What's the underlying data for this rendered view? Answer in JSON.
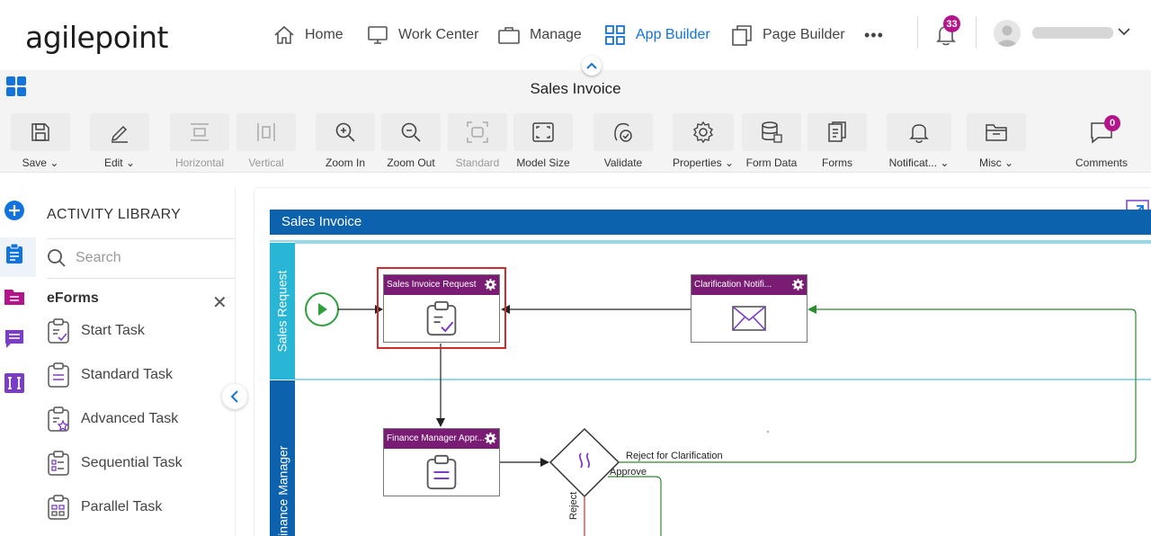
{
  "app": {
    "logo": "agilepoint"
  },
  "nav": {
    "items": [
      {
        "label": "Home",
        "icon": "home-icon"
      },
      {
        "label": "Work Center",
        "icon": "monitor-icon"
      },
      {
        "label": "Manage",
        "icon": "briefcase-icon"
      },
      {
        "label": "App Builder",
        "icon": "grid-icon",
        "active": true
      },
      {
        "label": "Page Builder",
        "icon": "pages-icon"
      }
    ],
    "more": "•••",
    "notification_count": "33"
  },
  "page": {
    "title": "Sales Invoice"
  },
  "toolbar": {
    "buttons": [
      {
        "label": "Save",
        "dropdown": true
      },
      {
        "label": "Edit",
        "dropdown": true
      },
      {
        "label": "Horizontal",
        "disabled": true
      },
      {
        "label": "Vertical",
        "disabled": true
      },
      {
        "label": "Zoom In"
      },
      {
        "label": "Zoom Out"
      },
      {
        "label": "Standard",
        "disabled": true
      },
      {
        "label": "Model Size"
      },
      {
        "label": "Validate"
      },
      {
        "label": "Properties",
        "dropdown": true
      },
      {
        "label": "Form Data"
      },
      {
        "label": "Forms"
      },
      {
        "label": "Notificat...",
        "dropdown": true
      },
      {
        "label": "Misc",
        "dropdown": true
      },
      {
        "label": "Comments"
      }
    ],
    "comments_count": "0"
  },
  "library": {
    "title": "ACTIVITY LIBRARY",
    "search_placeholder": "Search",
    "group": "eForms",
    "items": [
      {
        "label": "Start Task"
      },
      {
        "label": "Standard Task"
      },
      {
        "label": "Advanced Task"
      },
      {
        "label": "Sequential Task"
      },
      {
        "label": "Parallel Task"
      }
    ]
  },
  "process": {
    "pool": "Sales Invoice",
    "lanes": [
      {
        "label": "Sales Request",
        "color": "#29b6d6"
      },
      {
        "label": "Finance Manager",
        "color": "#0d62ad"
      }
    ],
    "tasks": [
      {
        "title": "Sales Invoice Request"
      },
      {
        "title": "Clarification Notifi..."
      },
      {
        "title": "Finance Manager Appr..."
      }
    ],
    "flows": {
      "reject_clarification": "Reject for Clarification",
      "approve": "Approve",
      "reject": "Reject"
    }
  },
  "colors": {
    "accent": "#1273de",
    "task_header": "#7a1c73",
    "badge": "#b5158a",
    "pool": "#0d62ad"
  }
}
